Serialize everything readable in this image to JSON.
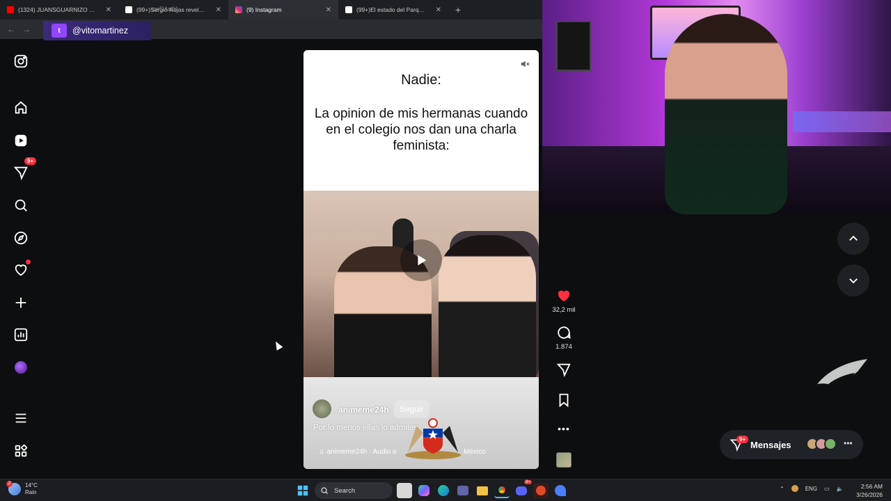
{
  "browser": {
    "tabs": [
      {
        "title": "(1324) JUANSGUARNIZO ¡SOBR",
        "favicon_color": "#ff0000",
        "active": false
      },
      {
        "title": "(99+)Sergio Rojas reveló en ¿Q",
        "favicon_color": "#ffffff",
        "active": false
      },
      {
        "title": "(9) Instagram",
        "favicon_color": "#e1306c",
        "active": true
      },
      {
        "title": "(99+)El estado del Parque O'Hig",
        "favicon_color": "#ffffff",
        "active": false
      }
    ],
    "new_tab_symbol": "+",
    "address_fragment": "cwDAu0/",
    "twitch_handle": "@vitomartinez"
  },
  "sidebar": {
    "items": [
      {
        "name": "instagram-logo-icon"
      },
      {
        "name": "home-icon"
      },
      {
        "name": "reels-icon"
      },
      {
        "name": "messages-icon",
        "badge": "9+"
      },
      {
        "name": "search-icon"
      },
      {
        "name": "explore-icon"
      },
      {
        "name": "notifications-icon"
      },
      {
        "name": "create-icon"
      },
      {
        "name": "dashboard-icon"
      },
      {
        "name": "profile-avatar"
      },
      {
        "name": "menu-icon"
      },
      {
        "name": "apps-icon"
      }
    ]
  },
  "reel": {
    "headline": "Nadie:",
    "text": "La opinion de mis hermanas cuando en el colegio nos dan una charla feminista:",
    "author": "animeme24h",
    "follow_label": "Seguir",
    "caption": "Por lo menos ellas lo admiten",
    "audio": "animeme24h · Audio o",
    "audio_tail": "México"
  },
  "actions": {
    "likes": "32,2 mil",
    "comments": "1.874",
    "like_color": "#ff3040"
  },
  "messages": {
    "label": "Mensajes",
    "badge": "9+"
  },
  "taskbar": {
    "temperature": "14°C",
    "condition": "Rain",
    "search_label": "Search",
    "language": "ENG",
    "time": "2:56 AM",
    "date": "3/26/2026",
    "discord_badge": "9+"
  }
}
